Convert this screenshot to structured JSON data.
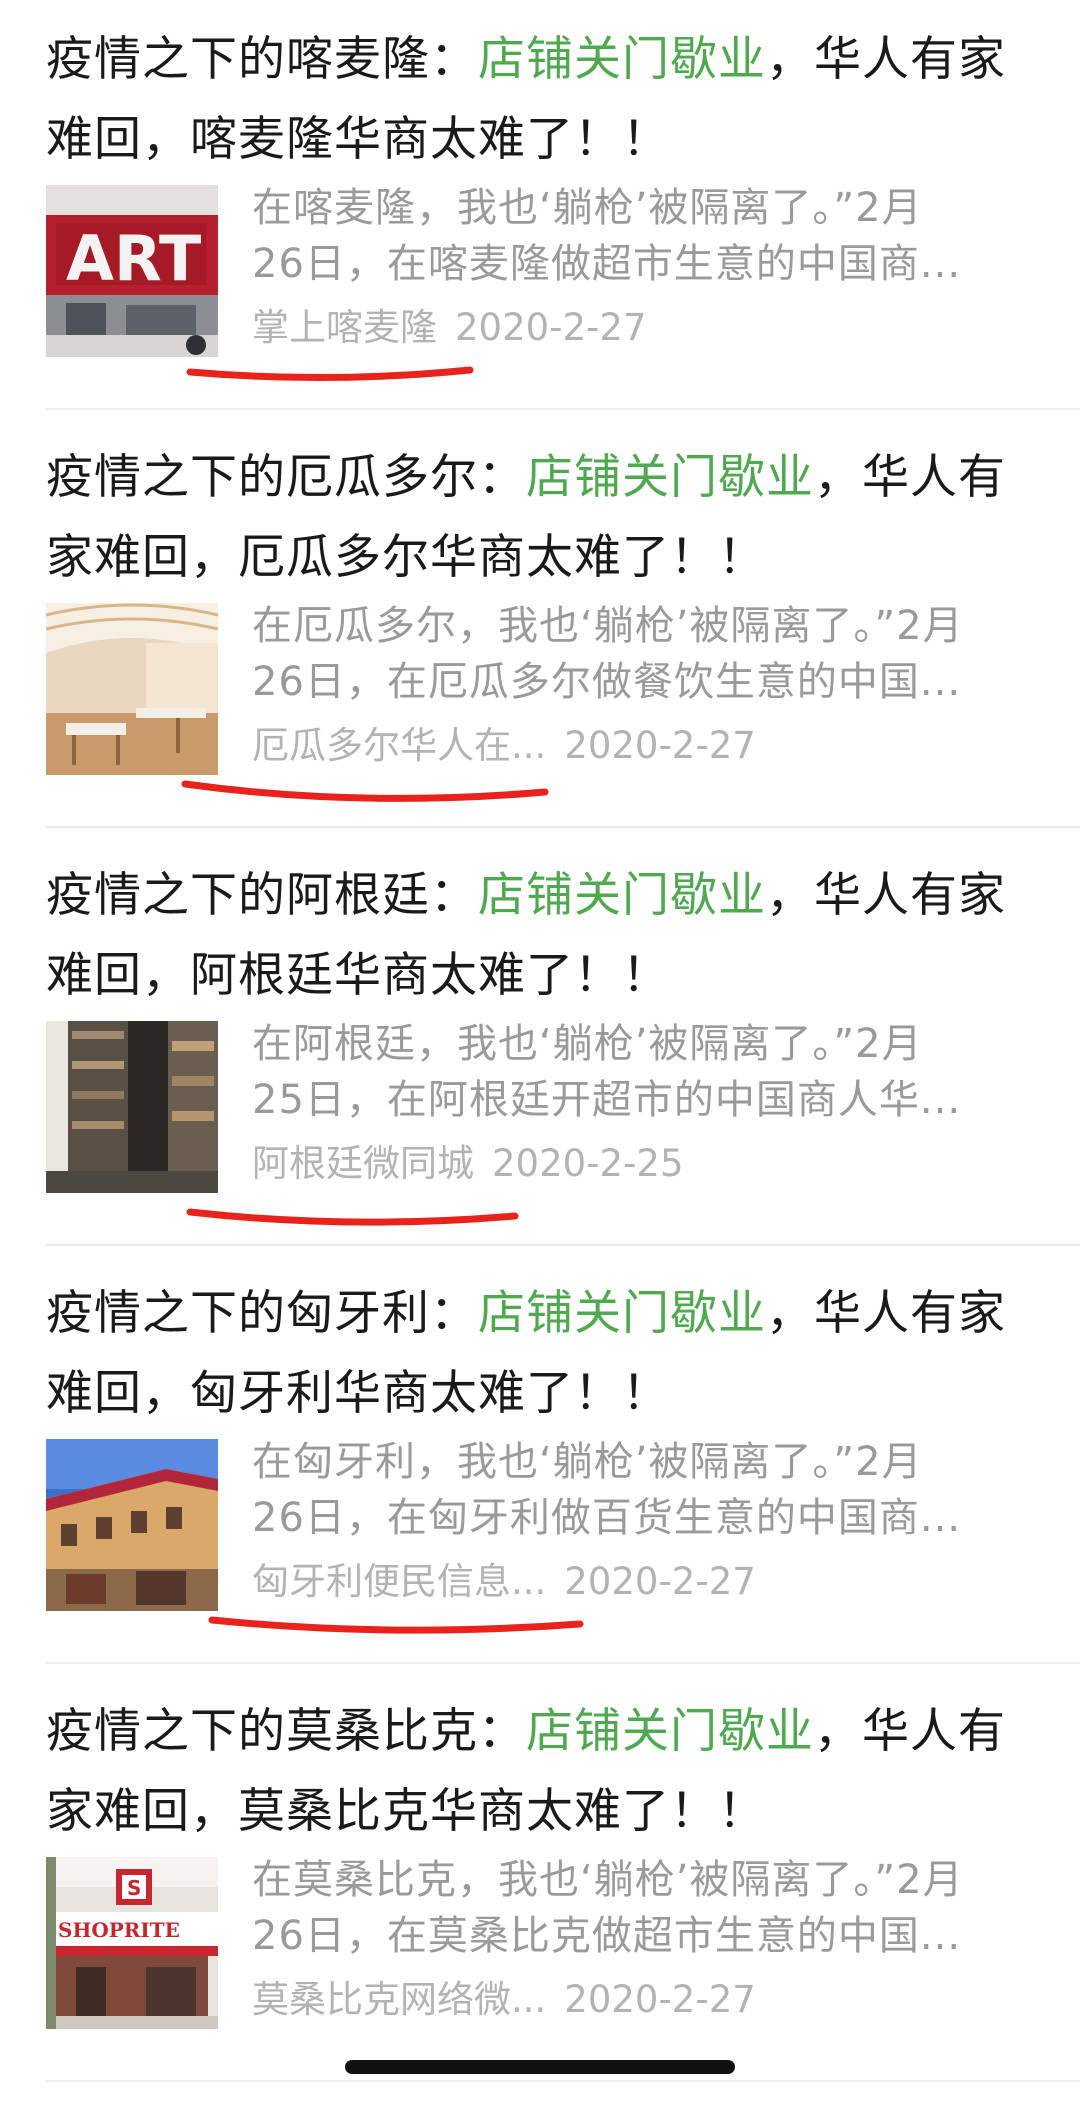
{
  "articles": [
    {
      "title_pre": "疫情之下的喀麦隆：",
      "title_hl": "店铺关门歇业",
      "title_post": "，华人有家难回，喀麦隆华商太难了！！",
      "desc_line1": "在喀麦隆，我也‘躺枪’被隔离了。”2月",
      "desc_line2": "26日，在喀麦隆做超市生意的中国商...",
      "source": "掌上喀麦隆",
      "date": "2020-2-27",
      "thumb_icon": "storefront-art-photo"
    },
    {
      "title_pre": "疫情之下的厄瓜多尔：",
      "title_hl": "店铺关门歇业",
      "title_post": "，华人有家难回，厄瓜多尔华商太难了！！",
      "desc_line1": "在厄瓜多尔，我也‘躺枪’被隔离了。”2月",
      "desc_line2": "26日，在厄瓜多尔做餐饮生意的中国...",
      "source": "厄瓜多尔华人在...",
      "date": "2020-2-27",
      "thumb_icon": "restaurant-interior-photo"
    },
    {
      "title_pre": "疫情之下的阿根廷：",
      "title_hl": "店铺关门歇业",
      "title_post": "，华人有家难回，阿根廷华商太难了！！",
      "desc_line1": "在阿根廷，我也‘躺枪’被隔离了。”2月",
      "desc_line2": "25日，在阿根廷开超市的中国商人华...",
      "source": "阿根廷微同城",
      "date": "2020-2-25",
      "thumb_icon": "supermarket-aisle-photo"
    },
    {
      "title_pre": "疫情之下的匈牙利：",
      "title_hl": "店铺关门歇业",
      "title_post": "，华人有家难回，匈牙利华商太难了！！",
      "desc_line1": "在匈牙利，我也‘躺枪’被隔离了。”2月",
      "desc_line2": "26日，在匈牙利做百货生意的中国商...",
      "source": "匈牙利便民信息...",
      "date": "2020-2-27",
      "thumb_icon": "street-building-photo"
    },
    {
      "title_pre": "疫情之下的莫桑比克：",
      "title_hl": "店铺关门歇业",
      "title_post": "，华人有家难回，莫桑比克华商太难了！！",
      "desc_line1": "在莫桑比克，我也‘躺枪’被隔离了。”2月",
      "desc_line2": "26日，在莫桑比克做超市生意的中国...",
      "source": "莫桑比克网络微...",
      "date": "2020-2-27",
      "thumb_icon": "shoprite-storefront-photo",
      "thumb_sign_text": "SHOPRITE"
    }
  ],
  "colors": {
    "highlight": "#4fa94f",
    "annotation": "#e8231b",
    "meta": "#b3b3b3",
    "desc": "#9a9a9a"
  }
}
